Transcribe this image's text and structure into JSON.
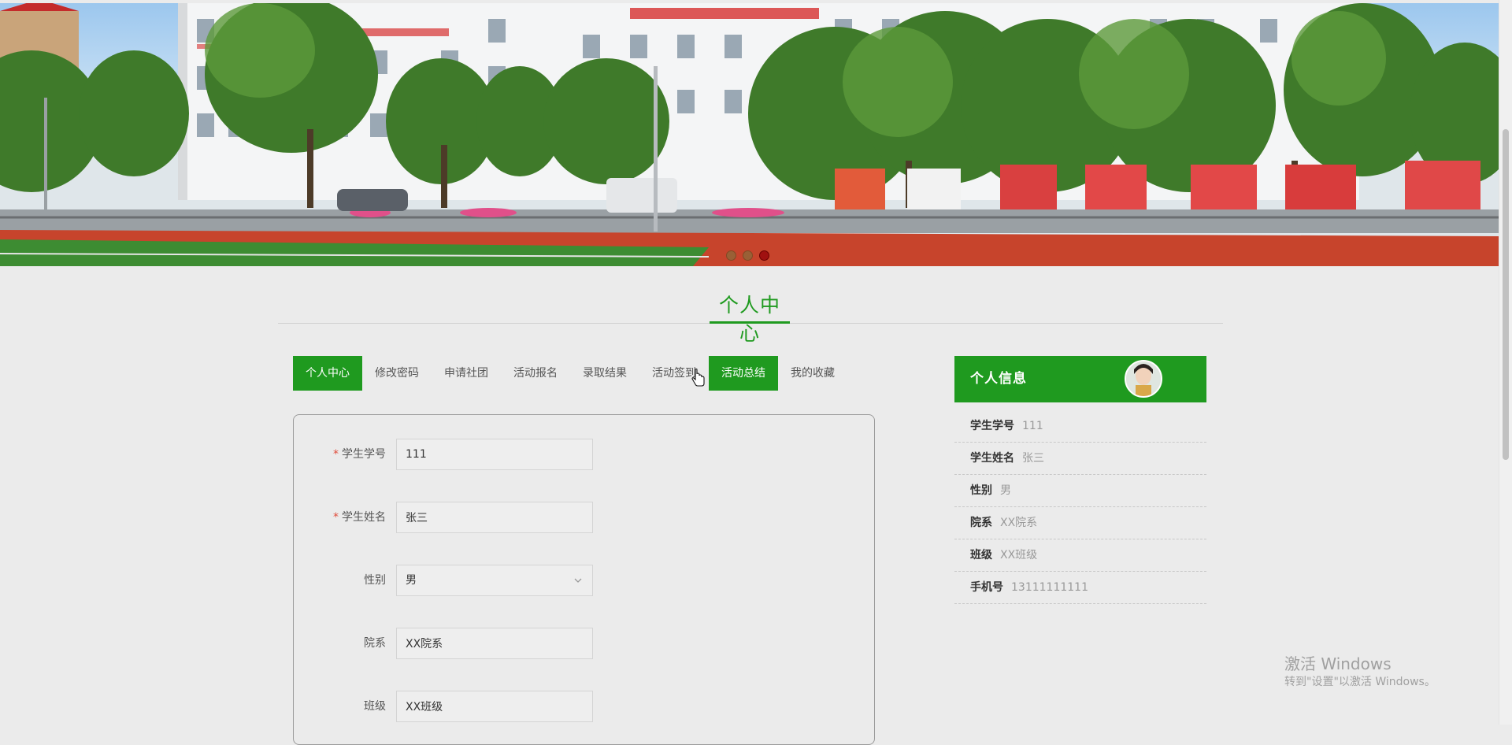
{
  "banner": {
    "slides": [
      "slide-1",
      "slide-2",
      "slide-3"
    ],
    "active_slide": 3
  },
  "section_title": "个人中心",
  "tabs": [
    {
      "label": "个人中心",
      "active": true
    },
    {
      "label": "修改密码",
      "active": false
    },
    {
      "label": "申请社团",
      "active": false
    },
    {
      "label": "活动报名",
      "active": false
    },
    {
      "label": "录取结果",
      "active": false
    },
    {
      "label": "活动签到",
      "active": false
    },
    {
      "label": "活动总结",
      "active": true
    },
    {
      "label": "我的收藏",
      "active": false
    }
  ],
  "form": {
    "student_id": {
      "label": "学生学号",
      "required": true,
      "value": "111"
    },
    "student_name": {
      "label": "学生姓名",
      "required": true,
      "value": "张三"
    },
    "gender": {
      "label": "性别",
      "required": false,
      "value": "男"
    },
    "department": {
      "label": "院系",
      "required": false,
      "value": "XX院系"
    },
    "class": {
      "label": "班级",
      "required": false,
      "value": "XX班级"
    }
  },
  "profile": {
    "title": "个人信息",
    "rows": [
      {
        "key": "学生学号",
        "value": "111"
      },
      {
        "key": "学生姓名",
        "value": "张三"
      },
      {
        "key": "性别",
        "value": "男"
      },
      {
        "key": "院系",
        "value": "XX院系"
      },
      {
        "key": "班级",
        "value": "XX班级"
      },
      {
        "key": "手机号",
        "value": "13111111111"
      }
    ]
  },
  "watermark": {
    "line1": "激活 Windows",
    "line2": "转到\"设置\"以激活 Windows。"
  },
  "colors": {
    "accent": "#1f9a1f",
    "required_star": "#e04b3a",
    "background": "#ebebeb"
  },
  "icons": {
    "select": "chevron-down-icon",
    "cursor": "hand-pointer-icon"
  }
}
